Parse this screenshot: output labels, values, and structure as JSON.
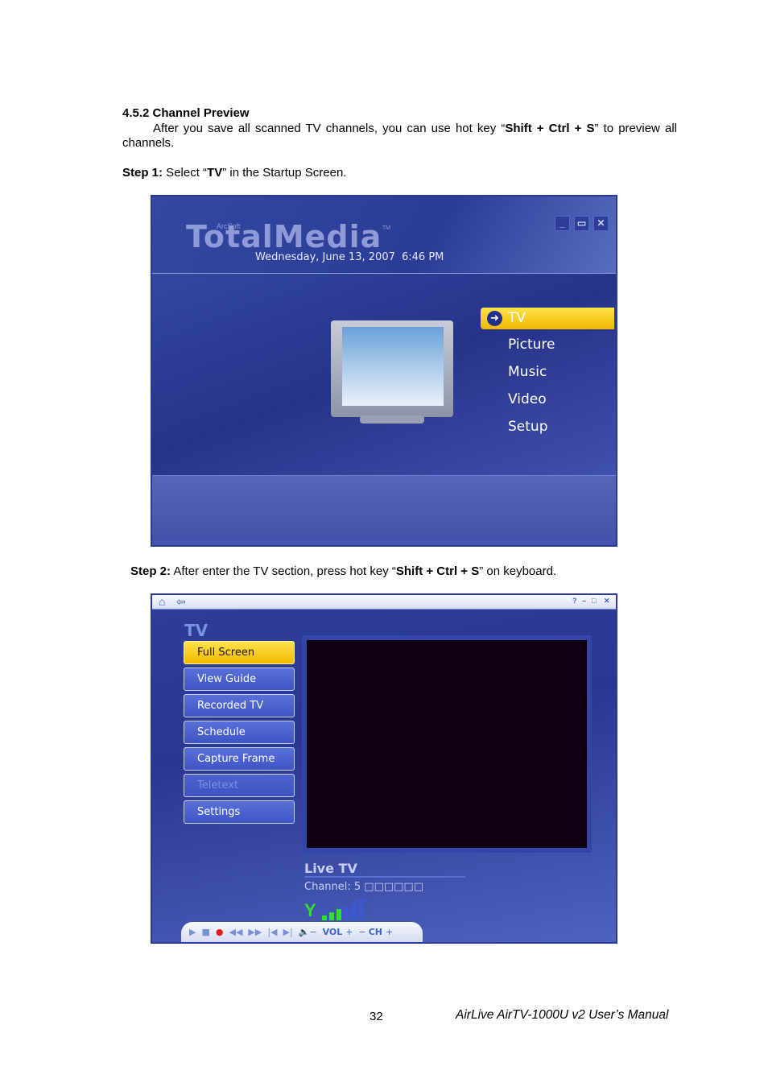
{
  "section_title": "4.5.2 Channel Preview",
  "intro": {
    "pre": "After you save all scanned TV channels, you can use hot key “",
    "key": "Shift + Ctrl + S",
    "post": "” to preview all channels."
  },
  "step1": {
    "label": "Step 1:",
    "pre": " Select “",
    "key": "TV",
    "post": "” in the Startup Screen."
  },
  "step2": {
    "label": "Step 2:",
    "pre": " After enter the TV section, press hot key “",
    "key": "Shift + Ctrl + S",
    "post": "” on keyboard."
  },
  "screen1": {
    "brand": "ArcSoft",
    "logo": "TotalMedia",
    "tm": "TM",
    "date": "Wednesday, June 13, 2007",
    "time": "6:46 PM",
    "menu": [
      {
        "label": "TV",
        "selected": true
      },
      {
        "label": "Picture"
      },
      {
        "label": "Music"
      },
      {
        "label": "Video"
      },
      {
        "label": "Setup"
      }
    ]
  },
  "screen2": {
    "title": "TV",
    "buttons": [
      {
        "label": "Full Screen",
        "state": "active"
      },
      {
        "label": "View Guide"
      },
      {
        "label": "Recorded TV"
      },
      {
        "label": "Schedule"
      },
      {
        "label": "Capture Frame"
      },
      {
        "label": "Teletext",
        "state": "disabled"
      },
      {
        "label": "Settings"
      }
    ],
    "live_label": "Live TV",
    "channel": "Channel: 5 □□□□□□",
    "signal_level": 3,
    "signal_max": 6,
    "controls": {
      "vol": "VOL",
      "ch": "CH"
    }
  },
  "footer": {
    "page": "32",
    "manual": "AirLive AirTV-1000U v2 User’s Manual"
  }
}
